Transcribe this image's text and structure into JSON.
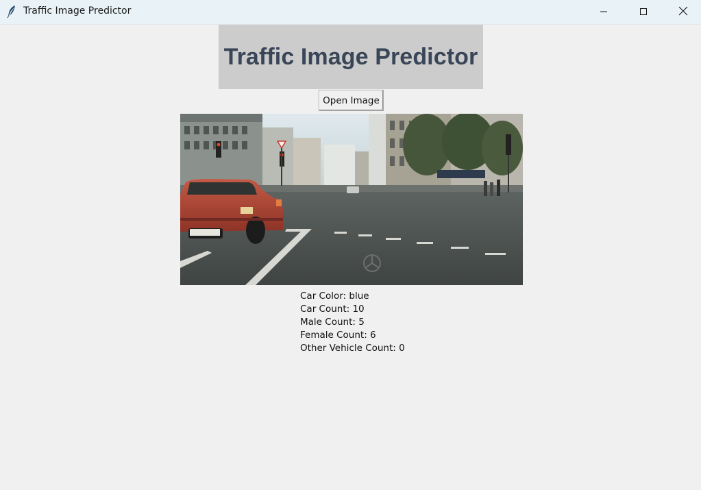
{
  "window": {
    "title": "Traffic Image Predictor",
    "icons": {
      "app": "feather-icon",
      "minimize": "minimize-icon",
      "maximize": "maximize-icon",
      "close": "close-icon"
    }
  },
  "header": {
    "title": "Traffic Image Predictor"
  },
  "controls": {
    "open_label": "Open Image"
  },
  "image": {
    "description_icon": "street-scene-photo"
  },
  "results": {
    "car_color": "Car Color: blue",
    "car_count": "Car Count: 10",
    "male_count": "Male Count: 5",
    "female_count": "Female Count: 6",
    "other_vehicle_count": "Other Vehicle Count: 0"
  },
  "colors": {
    "background": "#f0f0f0",
    "titlebar": "#e9f3f7",
    "header_box": "#cccccc",
    "header_text": "#3a4658"
  }
}
